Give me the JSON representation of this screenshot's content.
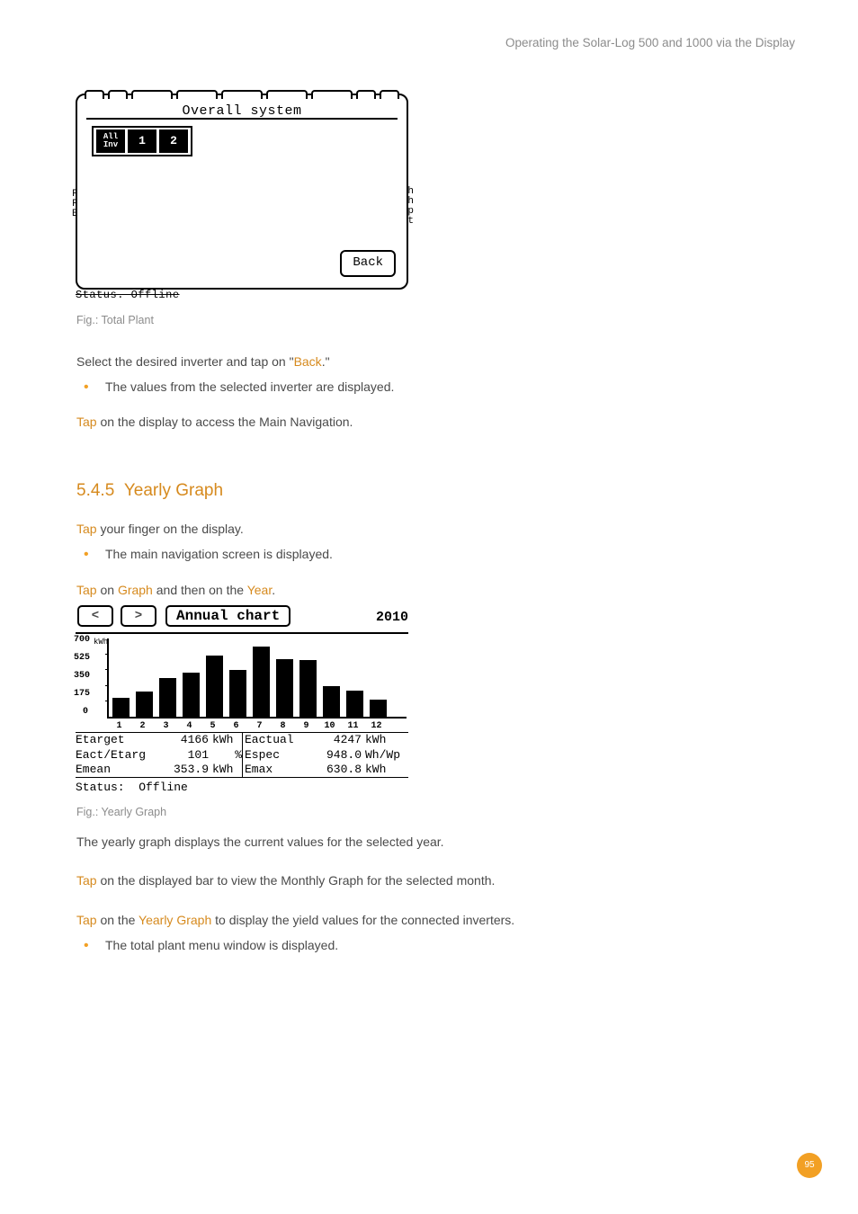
{
  "header": {
    "title": "Operating the Solar-Log 500 and 1000 via the Display"
  },
  "fig1": {
    "title": "Overall system",
    "inverter_tabs": [
      "All\nInv",
      "1",
      "2"
    ],
    "back_label": "Back",
    "status_glitch": "Status.   Offline",
    "caption": "Fig.: Total Plant"
  },
  "para1": {
    "pre": "Select the desired inverter and tap on \"",
    "link": "Back",
    "post": ".\"",
    "bullet": "The values from the selected inverter are displayed."
  },
  "para2": {
    "link": "Tap",
    "rest": " on the display to access the Main Navigation."
  },
  "section": {
    "number": "5.4.5",
    "title": "Yearly Graph"
  },
  "para3": {
    "link": "Tap",
    "rest": " your finger on the display.",
    "bullet": "The main navigation screen is displayed."
  },
  "para4": {
    "link1": "Tap",
    "mid1": " on ",
    "link2": "Graph",
    "mid2": " and then on the ",
    "link3": "Year",
    "post": "."
  },
  "annual": {
    "nav_prev": "<",
    "nav_next": ">",
    "title": "Annual chart",
    "year": "2010",
    "status_label": "Status:",
    "status_value": "Offline",
    "rows": [
      {
        "l": "Etarget",
        "lv": "4166",
        "lu": "kWh",
        "r": "Eactual",
        "rv": "4247",
        "ru": "kWh"
      },
      {
        "l": "Eact/Etarg",
        "lv": "101",
        "lu": "%",
        "r": "Espec",
        "rv": "948.0",
        "ru": "Wh/Wp"
      },
      {
        "l": "Emean",
        "lv": "353.9",
        "lu": "kWh",
        "r": "Emax",
        "rv": "630.8",
        "ru": "kWh"
      }
    ],
    "caption": "Fig.: Yearly Graph"
  },
  "chart_data": {
    "type": "bar",
    "title": "Annual chart",
    "ylabel": "kWh",
    "ylim": [
      0,
      700
    ],
    "y_ticks": [
      0,
      175,
      350,
      525,
      700
    ],
    "categories": [
      "1",
      "2",
      "3",
      "4",
      "5",
      "6",
      "7",
      "8",
      "9",
      "10",
      "11",
      "12"
    ],
    "values": [
      170,
      230,
      350,
      400,
      550,
      420,
      630,
      520,
      510,
      280,
      240,
      160
    ]
  },
  "para5": "The yearly graph displays the current values for the selected year.",
  "para6": {
    "link": "Tap",
    "rest": " on the displayed bar to view the Monthly Graph for the selected month."
  },
  "para7": {
    "link1": "Tap",
    "mid": " on the ",
    "link2": "Yearly Graph",
    "rest": " to display the yield values for the connected inverters.",
    "bullet": "The total plant menu window is displayed."
  },
  "page_number": "95"
}
